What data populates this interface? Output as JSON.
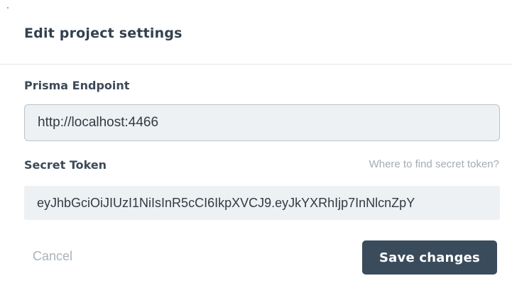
{
  "dialog": {
    "title": "Edit project settings"
  },
  "endpoint": {
    "label": "Prisma Endpoint",
    "value": "http://localhost:4466"
  },
  "token": {
    "label": "Secret Token",
    "help_link": "Where to find secret token?",
    "value": "eyJhbGciOiJIUzI1NiIsInR5cCI6IkpXVCJ9.eyJkYXRhIjp7InNlcnZpY"
  },
  "actions": {
    "cancel_label": "Cancel",
    "save_label": "Save changes"
  },
  "colors": {
    "primary_button": "#3a4c5c",
    "input_background": "#eef1f3",
    "muted_text": "#a3acb5"
  }
}
